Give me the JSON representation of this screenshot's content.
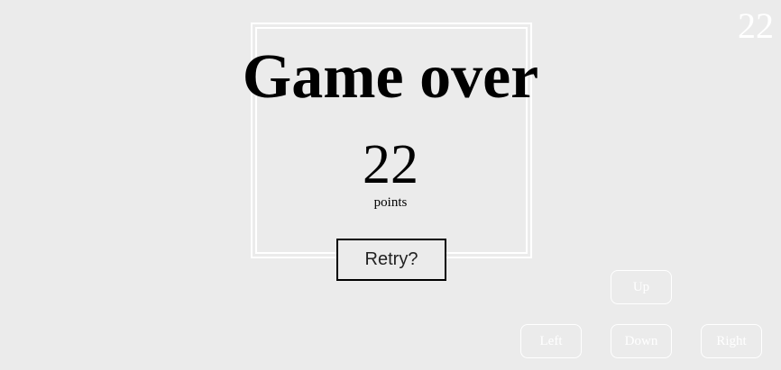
{
  "hud": {
    "score": "22"
  },
  "game_over": {
    "title": "Game over",
    "score": "22",
    "score_unit": "points",
    "retry_label": "Retry?"
  },
  "controls": {
    "up": "Up",
    "left": "Left",
    "down": "Down",
    "right": "Right"
  },
  "colors": {
    "background": "#ebebeb",
    "frame": "#ffffff",
    "text": "#000000",
    "control_text": "#ffffff"
  }
}
